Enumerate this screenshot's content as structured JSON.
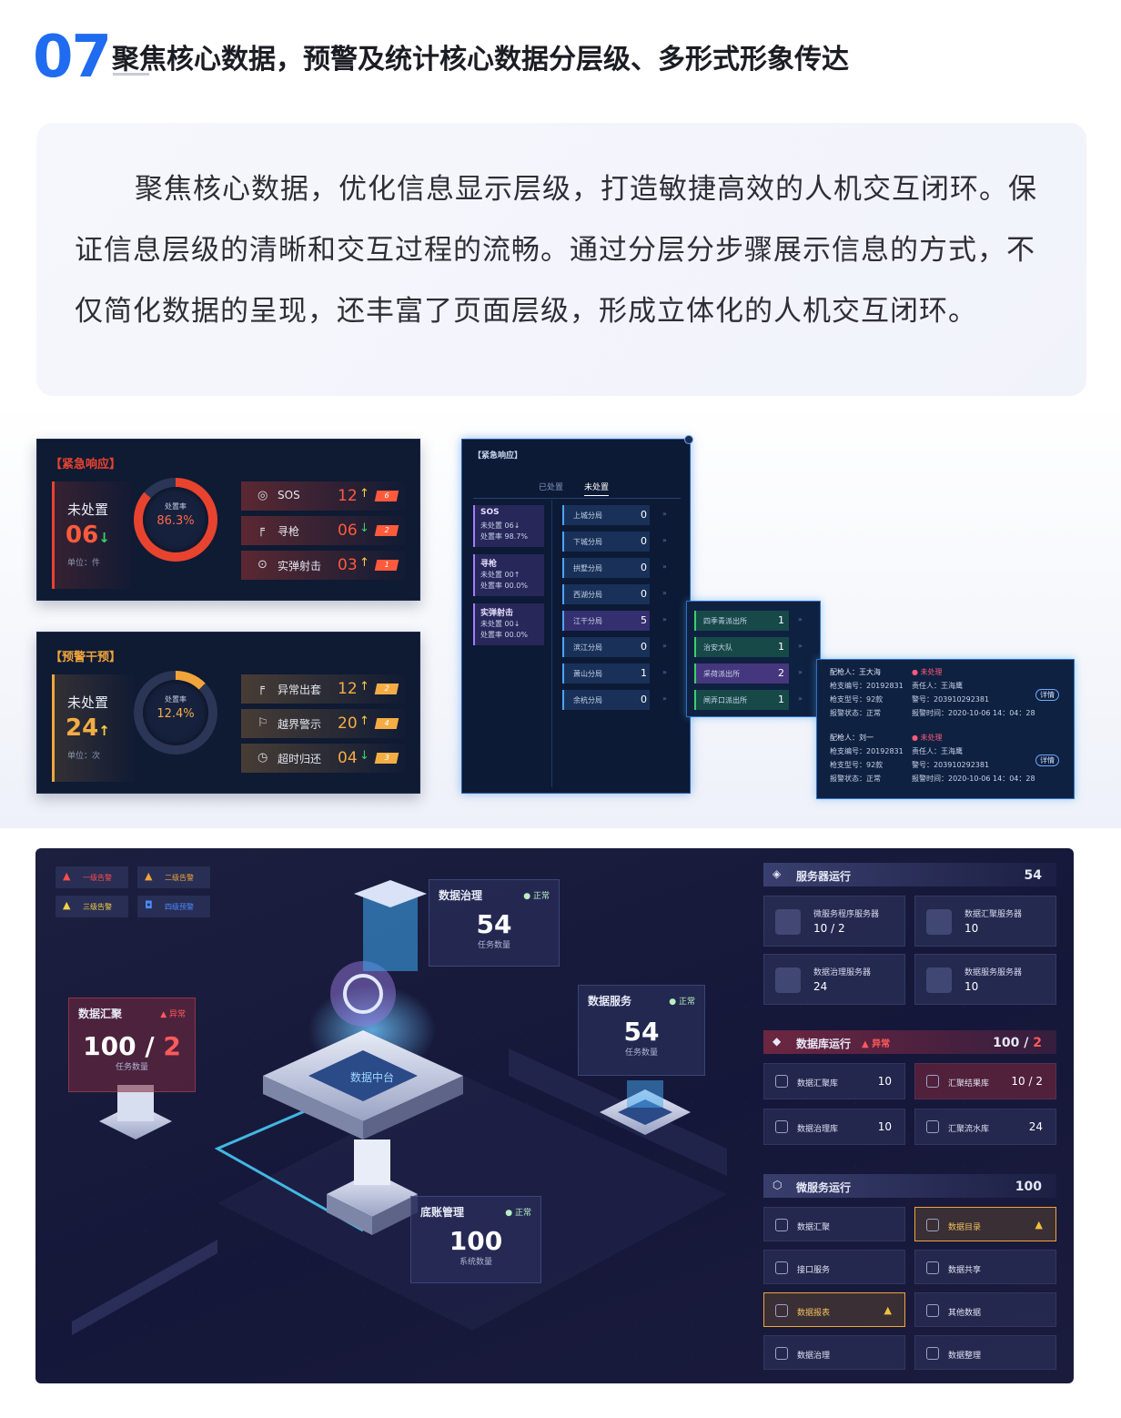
{
  "header": {
    "number": "07",
    "title": "聚焦核心数据，预警及统计核心数据分层级、多形式形象传达"
  },
  "intro": "聚焦核心数据，优化信息显示层级，打造敏捷高效的人机交互闭环。保证信息层级的清晰和交互过程的流畅。通过分层分步骤展示信息的方式，不仅简化数据的呈现，还丰富了页面层级，形成立体化的人机交互闭环。",
  "colors": {
    "accent": "#1f6cf0",
    "red": "#e8432f",
    "orange": "#f0a53a",
    "green": "#3ad06a"
  },
  "emergency": {
    "title": "【紧急响应】",
    "label": "未处置",
    "value": "06",
    "arrow": "↓",
    "unit": "单位：件",
    "rate_label": "处置率",
    "rate": "86.3%",
    "rate_fraction": 0.863,
    "rows": [
      {
        "icon": "◎",
        "name": "SOS",
        "value": "12",
        "arrow": "↑",
        "flag": "6"
      },
      {
        "icon": "╒",
        "name": "寻枪",
        "value": "06",
        "arrow": "↓",
        "flag": "2"
      },
      {
        "icon": "⊙",
        "name": "实弹射击",
        "value": "03",
        "arrow": "↑",
        "flag": "1"
      }
    ]
  },
  "warning": {
    "title": "【预警干预】",
    "label": "未处置",
    "value": "24",
    "arrow": "↑",
    "unit": "单位：次",
    "rate_label": "处置率",
    "rate": "12.4%",
    "rate_fraction": 0.124,
    "rows": [
      {
        "icon": "╒",
        "name": "异常出套",
        "value": "12",
        "arrow": "↑",
        "flag": "2"
      },
      {
        "icon": "⚐",
        "name": "越界警示",
        "value": "20",
        "arrow": "↑",
        "flag": "4"
      },
      {
        "icon": "◷",
        "name": "超时归还",
        "value": "04",
        "arrow": "↓",
        "flag": "3"
      }
    ]
  },
  "midlist": {
    "title": "【紧急响应】",
    "tabs": [
      "已处置",
      "未处置"
    ],
    "groups": [
      {
        "name": "SOS",
        "l1": "未处置",
        "v1": "06↓",
        "l2": "处置率",
        "v2": "98.7%"
      },
      {
        "name": "寻枪",
        "l1": "未处置",
        "v1": "00↑",
        "l2": "处置率",
        "v2": "00.0%"
      },
      {
        "name": "实弹射击",
        "l1": "未处置",
        "v1": "00↓",
        "l2": "处置率",
        "v2": "00.0%"
      }
    ],
    "branches": [
      {
        "name": "上城分局",
        "value": "0"
      },
      {
        "name": "下城分局",
        "value": "0"
      },
      {
        "name": "拱墅分局",
        "value": "0"
      },
      {
        "name": "西湖分局",
        "value": "0"
      },
      {
        "name": "江干分局",
        "value": "5"
      },
      {
        "name": "滨江分局",
        "value": "0"
      },
      {
        "name": "萧山分局",
        "value": "1"
      },
      {
        "name": "余杭分局",
        "value": "0"
      }
    ],
    "stations": [
      {
        "name": "四季青派出所",
        "value": "1"
      },
      {
        "name": "治安大队",
        "value": "1"
      },
      {
        "name": "采荷派出所",
        "value": "2"
      },
      {
        "name": "闸弄口派出所",
        "value": "1"
      }
    ],
    "details": [
      {
        "a": "配枪人：王大海",
        "b": "未处理",
        "c": "枪支编号：20192831",
        "d": "责任人：王海鹰",
        "e": "枪支型号：92款",
        "f": "警号：203910292381",
        "g": "报警状态：正常",
        "h": "报警时间：2020-10-06 14：04：28",
        "btn": "详情"
      },
      {
        "a": "配枪人：刘一",
        "b": "未处理",
        "c": "枪支编号：20192831",
        "d": "责任人：王海鹰",
        "e": "枪支型号：92款",
        "f": "警号：203910292381",
        "g": "报警状态：正常",
        "h": "报警时间：2020-10-06 14：04：28",
        "btn": "详情"
      }
    ]
  },
  "dashboard": {
    "legend": [
      "一级告警",
      "二级告警",
      "三级告警",
      "四级预警"
    ],
    "cards": [
      {
        "title": "数据治理",
        "status": "正常",
        "value": "54",
        "caption": "任务数量"
      },
      {
        "title": "数据汇聚",
        "status": "异常",
        "value_a": "100",
        "value_b": "2",
        "caption": "任务数量"
      },
      {
        "title": "数据服务",
        "status": "正常",
        "value": "54",
        "caption": "任务数量"
      },
      {
        "title": "底账管理",
        "status": "正常",
        "value": "100",
        "caption": "系统数量"
      }
    ],
    "core_label": "数据中台",
    "server": {
      "title": "服务器运行",
      "total": "54",
      "items": [
        {
          "name": "微服务程序服务器",
          "value": "10 / 2"
        },
        {
          "name": "数据汇聚服务器",
          "value": "10"
        },
        {
          "name": "数据治理服务器",
          "value": "24"
        },
        {
          "name": "数据服务服务器",
          "value": "10"
        }
      ]
    },
    "database": {
      "title": "数据库运行",
      "status": "异常",
      "total_a": "100",
      "total_b": "2",
      "items": [
        {
          "name": "数据汇聚库",
          "value": "10"
        },
        {
          "name": "汇聚结果库",
          "value": "10 / 2"
        },
        {
          "name": "数据治理库",
          "value": "10"
        },
        {
          "name": "汇聚流水库",
          "value": "24"
        }
      ]
    },
    "micro": {
      "title": "微服务运行",
      "total": "100",
      "items": [
        "数据汇聚",
        "数据目录",
        "接口服务",
        "数据共享",
        "数据报表",
        "其他数据",
        "数据治理",
        "数据整理"
      ]
    }
  }
}
